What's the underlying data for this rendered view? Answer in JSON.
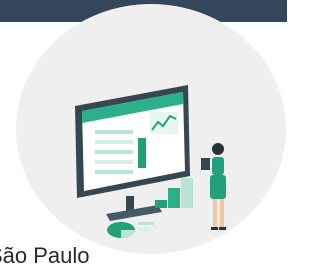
{
  "header": {
    "color": "#34475a"
  },
  "illustration": {
    "accent": "#22a07a",
    "background": "#efefef",
    "icons": [
      "monitor-icon",
      "chart-icon",
      "person-icon",
      "pie-chart-icon"
    ]
  },
  "caption": {
    "text": "São Paulo"
  }
}
